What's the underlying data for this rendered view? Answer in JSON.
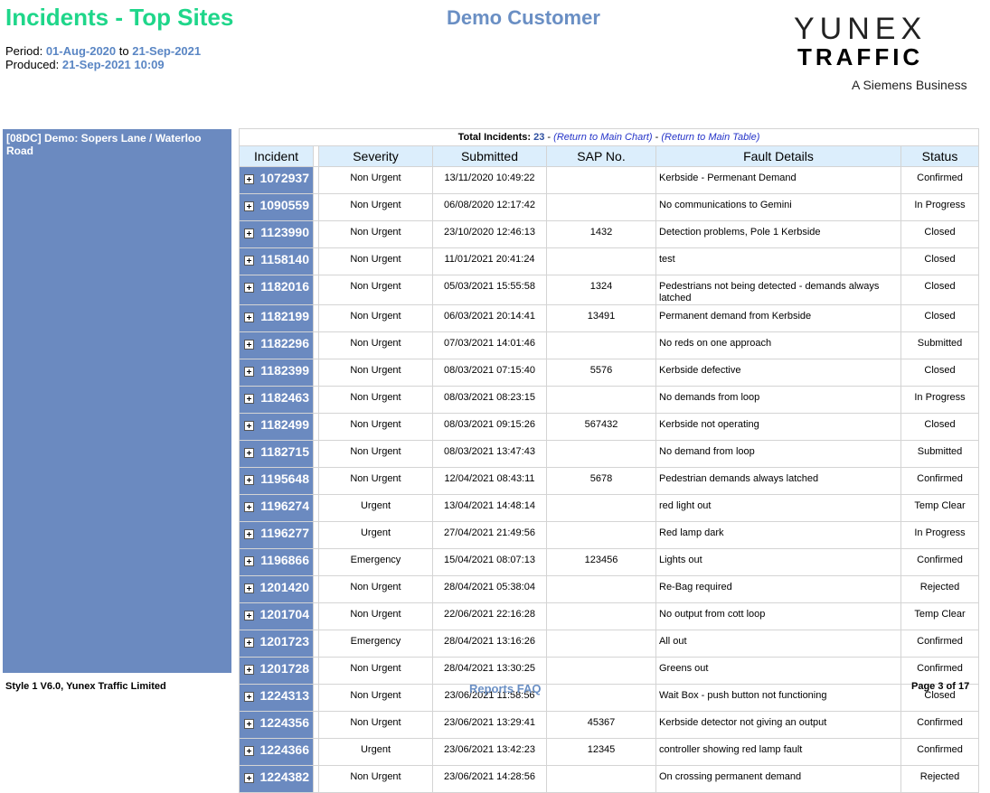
{
  "header": {
    "title": "Incidents - Top Sites",
    "customer": "Demo Customer",
    "period_label": "Period:",
    "period_from": "01-Aug-2020",
    "period_to_word": "to",
    "period_to": "21-Sep-2021",
    "produced_label": "Produced:",
    "produced": "21-Sep-2021 10:09"
  },
  "logo": {
    "line1": "YUNEX",
    "line2": "TRAFFIC",
    "line3": "A Siemens Business"
  },
  "sidebar": {
    "site": "[08DC] Demo: Sopers Lane / Waterloo Road"
  },
  "summary": {
    "label": "Total Incidents:",
    "count": "23",
    "sep1": " - ",
    "link_chart": "(Return to Main Chart)",
    "sep2": " - ",
    "link_table": "(Return to Main Table)"
  },
  "columns": [
    "Incident",
    "Severity",
    "Submitted",
    "SAP No.",
    "Fault Details",
    "Status"
  ],
  "rows": [
    {
      "id": "1072937",
      "severity": "Non Urgent",
      "submitted": "13/11/2020 10:49:22",
      "sap": "",
      "fault": "Kerbside - Permenant Demand",
      "status": "Confirmed"
    },
    {
      "id": "1090559",
      "severity": "Non Urgent",
      "submitted": "06/08/2020 12:17:42",
      "sap": "",
      "fault": "No communications to Gemini",
      "status": "In Progress"
    },
    {
      "id": "1123990",
      "severity": "Non Urgent",
      "submitted": "23/10/2020 12:46:13",
      "sap": "1432",
      "fault": "Detection problems, Pole 1 Kerbside",
      "status": "Closed"
    },
    {
      "id": "1158140",
      "severity": "Non Urgent",
      "submitted": "11/01/2021 20:41:24",
      "sap": "",
      "fault": "test",
      "status": "Closed"
    },
    {
      "id": "1182016",
      "severity": "Non Urgent",
      "submitted": "05/03/2021 15:55:58",
      "sap": "1324",
      "fault": "Pedestrians not being detected - demands always latched",
      "status": "Closed"
    },
    {
      "id": "1182199",
      "severity": "Non Urgent",
      "submitted": "06/03/2021 20:14:41",
      "sap": "13491",
      "fault": "Permanent demand from Kerbside",
      "status": "Closed"
    },
    {
      "id": "1182296",
      "severity": "Non Urgent",
      "submitted": "07/03/2021 14:01:46",
      "sap": "",
      "fault": "No reds on one approach",
      "status": "Submitted"
    },
    {
      "id": "1182399",
      "severity": "Non Urgent",
      "submitted": "08/03/2021 07:15:40",
      "sap": "5576",
      "fault": "Kerbside defective",
      "status": "Closed"
    },
    {
      "id": "1182463",
      "severity": "Non Urgent",
      "submitted": "08/03/2021 08:23:15",
      "sap": "",
      "fault": "No demands from loop",
      "status": "In Progress"
    },
    {
      "id": "1182499",
      "severity": "Non Urgent",
      "submitted": "08/03/2021 09:15:26",
      "sap": "567432",
      "fault": "Kerbside not operating",
      "status": "Closed"
    },
    {
      "id": "1182715",
      "severity": "Non Urgent",
      "submitted": "08/03/2021 13:47:43",
      "sap": "",
      "fault": "No demand from loop",
      "status": "Submitted"
    },
    {
      "id": "1195648",
      "severity": "Non Urgent",
      "submitted": "12/04/2021 08:43:11",
      "sap": "5678",
      "fault": "Pedestrian demands always latched",
      "status": "Confirmed"
    },
    {
      "id": "1196274",
      "severity": "Urgent",
      "submitted": "13/04/2021 14:48:14",
      "sap": "",
      "fault": "red light out",
      "status": "Temp Clear"
    },
    {
      "id": "1196277",
      "severity": "Urgent",
      "submitted": "27/04/2021 21:49:56",
      "sap": "",
      "fault": "Red lamp dark",
      "status": "In Progress"
    },
    {
      "id": "1196866",
      "severity": "Emergency",
      "submitted": "15/04/2021 08:07:13",
      "sap": "123456",
      "fault": "Lights out",
      "status": "Confirmed"
    },
    {
      "id": "1201420",
      "severity": "Non Urgent",
      "submitted": "28/04/2021 05:38:04",
      "sap": "",
      "fault": "Re-Bag required",
      "status": "Rejected"
    },
    {
      "id": "1201704",
      "severity": "Non Urgent",
      "submitted": "22/06/2021 22:16:28",
      "sap": "",
      "fault": "No output from cott loop",
      "status": "Temp Clear"
    },
    {
      "id": "1201723",
      "severity": "Emergency",
      "submitted": "28/04/2021 13:16:26",
      "sap": "",
      "fault": "All out",
      "status": "Confirmed"
    },
    {
      "id": "1201728",
      "severity": "Non Urgent",
      "submitted": "28/04/2021 13:30:25",
      "sap": "",
      "fault": "Greens out",
      "status": "Confirmed"
    },
    {
      "id": "1224313",
      "severity": "Non Urgent",
      "submitted": "23/06/2021 11:58:56",
      "sap": "",
      "fault": "Wait Box - push button not functioning",
      "status": "Closed"
    },
    {
      "id": "1224356",
      "severity": "Non Urgent",
      "submitted": "23/06/2021 13:29:41",
      "sap": "45367",
      "fault": "Kerbside detector not giving an output",
      "status": "Confirmed"
    },
    {
      "id": "1224366",
      "severity": "Urgent",
      "submitted": "23/06/2021 13:42:23",
      "sap": "12345",
      "fault": "controller showing red lamp fault",
      "status": "Confirmed"
    },
    {
      "id": "1224382",
      "severity": "Non Urgent",
      "submitted": "23/06/2021 14:28:56",
      "sap": "",
      "fault": "On crossing permanent demand",
      "status": "Rejected"
    }
  ],
  "footer": {
    "left": "Style 1 V6.0, Yunex Traffic Limited",
    "middle": "Reports FAQ",
    "right": "Page 3 of 17"
  },
  "colors": {
    "title": "#1fd68a",
    "accent": "#6a8fc4",
    "sidebar": "#6b8ac0",
    "header_row": "#dceefc"
  },
  "icons": {
    "expand": "plus-box-icon"
  }
}
